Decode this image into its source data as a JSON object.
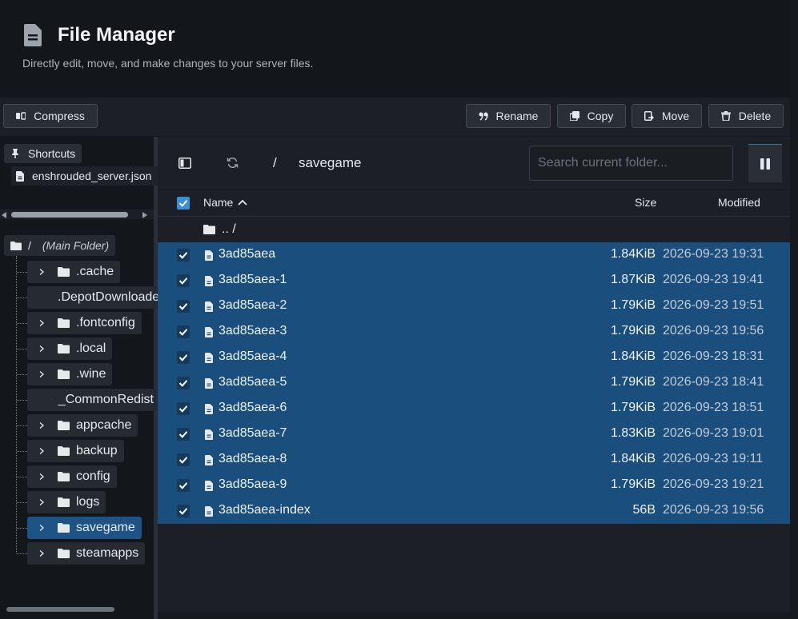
{
  "header": {
    "title": "File Manager",
    "subtitle": "Directly edit, move, and make changes to your server files.",
    "icon": "document-icon"
  },
  "toolbar": {
    "compress": "Compress",
    "rename": "Rename",
    "copy": "Copy",
    "move": "Move",
    "delete": "Delete"
  },
  "sidebar": {
    "shortcuts_label": "Shortcuts",
    "shortcut_file": "enshrouded_server.json",
    "root_slash": "/",
    "root_label": "(Main Folder)",
    "folders": [
      {
        "name": ".cache",
        "selected": false
      },
      {
        "name": ".DepotDownloader",
        "selected": false
      },
      {
        "name": ".fontconfig",
        "selected": false
      },
      {
        "name": ".local",
        "selected": false
      },
      {
        "name": ".wine",
        "selected": false
      },
      {
        "name": "_CommonRedist",
        "selected": false
      },
      {
        "name": "appcache",
        "selected": false
      },
      {
        "name": "backup",
        "selected": false
      },
      {
        "name": "config",
        "selected": false
      },
      {
        "name": "logs",
        "selected": false
      },
      {
        "name": "savegame",
        "selected": true
      },
      {
        "name": "steamapps",
        "selected": false
      }
    ]
  },
  "pathbar": {
    "separator": "/",
    "current": "savegame",
    "search_placeholder": "Search current folder..."
  },
  "table": {
    "col_name": "Name",
    "col_size": "Size",
    "col_modified": "Modified",
    "up_label": ".. /",
    "rows": [
      {
        "name": "3ad85aea",
        "size": "1.84KiB",
        "modified": "2026-09-23 19:31"
      },
      {
        "name": "3ad85aea-1",
        "size": "1.87KiB",
        "modified": "2026-09-23 19:41"
      },
      {
        "name": "3ad85aea-2",
        "size": "1.79KiB",
        "modified": "2026-09-23 19:51"
      },
      {
        "name": "3ad85aea-3",
        "size": "1.79KiB",
        "modified": "2026-09-23 19:56"
      },
      {
        "name": "3ad85aea-4",
        "size": "1.84KiB",
        "modified": "2026-09-23 18:31"
      },
      {
        "name": "3ad85aea-5",
        "size": "1.79KiB",
        "modified": "2026-09-23 18:41"
      },
      {
        "name": "3ad85aea-6",
        "size": "1.79KiB",
        "modified": "2026-09-23 18:51"
      },
      {
        "name": "3ad85aea-7",
        "size": "1.83KiB",
        "modified": "2026-09-23 19:01"
      },
      {
        "name": "3ad85aea-8",
        "size": "1.84KiB",
        "modified": "2026-09-23 19:11"
      },
      {
        "name": "3ad85aea-9",
        "size": "1.79KiB",
        "modified": "2026-09-23 19:21"
      },
      {
        "name": "3ad85aea-index",
        "size": "56B",
        "modified": "2026-09-23 19:56"
      }
    ]
  },
  "colors": {
    "selected_row": "#1a4e7c",
    "selected_folder": "#1e5385",
    "checkbox": "#3b8fd6"
  }
}
